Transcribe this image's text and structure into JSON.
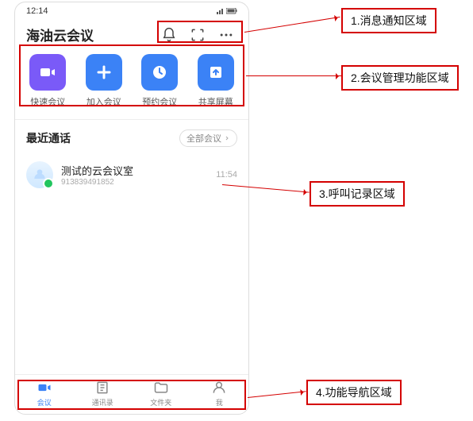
{
  "status": {
    "time": "12:14"
  },
  "header": {
    "title": "海油云会议"
  },
  "actions": [
    {
      "label": "快速会议"
    },
    {
      "label": "加入会议"
    },
    {
      "label": "预约会议"
    },
    {
      "label": "共享屏幕"
    }
  ],
  "recent": {
    "title": "最近通话",
    "all_label": "全部会议"
  },
  "calls": [
    {
      "name": "测试的云会议室",
      "sub": "913839491852",
      "time": "11:54"
    }
  ],
  "nav": [
    {
      "label": "会议",
      "active": true
    },
    {
      "label": "通讯录",
      "active": false
    },
    {
      "label": "文件夹",
      "active": false
    },
    {
      "label": "我",
      "active": false
    }
  ],
  "annotations": {
    "c1": "1.消息通知区域",
    "c2": "2.会议管理功能区域",
    "c3": "3.呼叫记录区域",
    "c4": "4.功能导航区域"
  }
}
